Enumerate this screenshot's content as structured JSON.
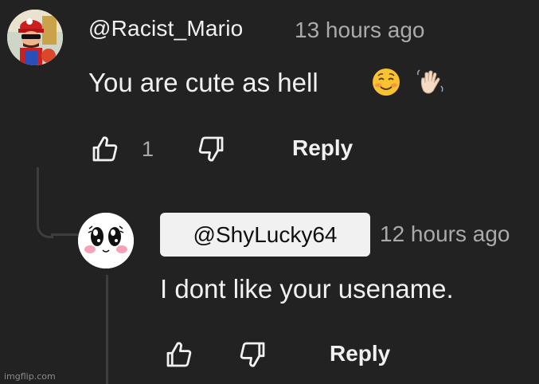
{
  "comment": {
    "author": "@Racist_Mario",
    "time": "13 hours ago",
    "text": "You are cute as hell",
    "emojis": [
      "smiling-face-icon",
      "waving-hand-icon"
    ],
    "like_count": "1",
    "reply_label": "Reply"
  },
  "reply": {
    "author": "@ShyLucky64",
    "time": "12 hours ago",
    "text": "I dont like your usename.",
    "reply_label": "Reply"
  },
  "watermark": "imgflip.com",
  "colors": {
    "background": "#222222",
    "text": "#f1f1f1",
    "muted": "#aaaaaa",
    "thread_line": "#3d3d3d",
    "mention_bg": "#f1f1f1"
  }
}
